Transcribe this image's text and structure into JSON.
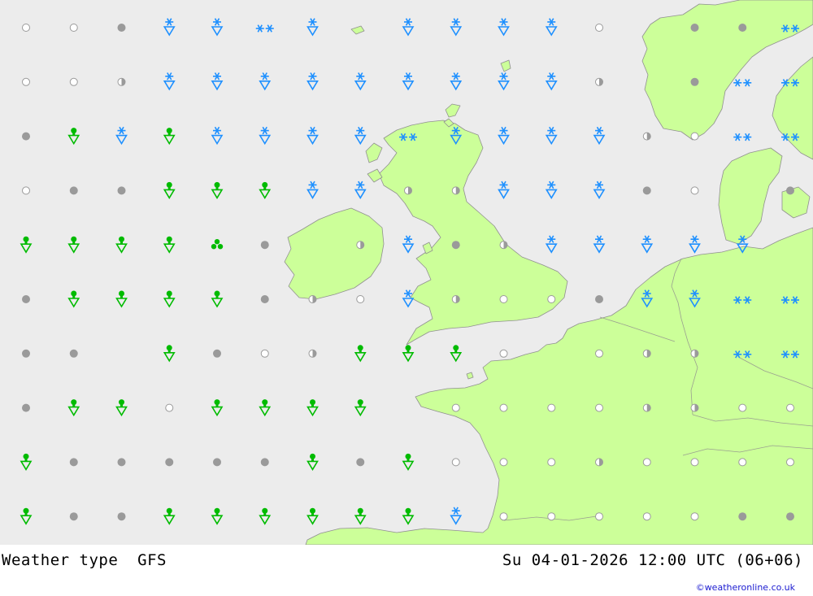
{
  "legend_title": "Weather type",
  "model": "GFS",
  "valid_time": "Su 04-01-2026 12:00 UTC (06+06)",
  "credit": "©weatheronline.co.uk",
  "colors": {
    "sea": "#ececec",
    "land": "#ccff99",
    "coast": "#909090",
    "snow": "#1e90ff",
    "rain": "#00bb00",
    "cloud": "#9a9a9a"
  },
  "legend": {
    "clear": "open circle",
    "partly_cloudy": "half-filled circle",
    "overcast": "filled gray circle",
    "rain": "green drop with triangle",
    "showers": "green clustered dots",
    "snow": "blue asterisk with triangle",
    "heavy_snow": "double blue asterisk"
  },
  "grid": {
    "rows": [
      [
        "clear",
        "clear",
        "overcast",
        "snow",
        "snow",
        "heavy_snow",
        "snow",
        "",
        "snow",
        "snow",
        "snow",
        "snow",
        "clear",
        "",
        "overcast",
        "overcast",
        "heavy_snow"
      ],
      [
        "clear",
        "clear",
        "partly_cloudy",
        "snow",
        "snow",
        "snow",
        "snow",
        "snow",
        "snow",
        "snow",
        "snow",
        "snow",
        "partly_cloudy",
        "",
        "overcast",
        "heavy_snow",
        "heavy_snow"
      ],
      [
        "overcast",
        "rain",
        "snow",
        "rain",
        "snow",
        "snow",
        "snow",
        "snow",
        "heavy_snow",
        "snow",
        "snow",
        "snow",
        "snow",
        "partly_cloudy",
        "clear",
        "heavy_snow",
        "heavy_snow"
      ],
      [
        "clear",
        "overcast",
        "overcast",
        "rain",
        "rain",
        "rain",
        "snow",
        "snow",
        "partly_cloudy",
        "partly_cloudy",
        "snow",
        "snow",
        "snow",
        "overcast",
        "clear",
        "",
        "overcast"
      ],
      [
        "rain",
        "rain",
        "rain",
        "rain",
        "showers",
        "overcast",
        "",
        "partly_cloudy",
        "snow",
        "overcast",
        "partly_cloudy",
        "snow",
        "snow",
        "snow",
        "snow",
        "snow",
        ""
      ],
      [
        "overcast",
        "rain",
        "rain",
        "rain",
        "rain",
        "overcast",
        "partly_cloudy",
        "clear",
        "snow",
        "partly_cloudy",
        "clear",
        "clear",
        "overcast",
        "snow",
        "snow",
        "heavy_snow",
        "heavy_snow"
      ],
      [
        "overcast",
        "overcast",
        "",
        "rain",
        "overcast",
        "clear",
        "partly_cloudy",
        "rain",
        "rain",
        "rain",
        "clear",
        "",
        "clear",
        "partly_cloudy",
        "partly_cloudy",
        "heavy_snow",
        "heavy_snow"
      ],
      [
        "overcast",
        "rain",
        "rain",
        "clear",
        "rain",
        "rain",
        "rain",
        "rain",
        "",
        "clear",
        "clear",
        "clear",
        "clear",
        "partly_cloudy",
        "partly_cloudy",
        "clear",
        "clear"
      ],
      [
        "rain",
        "overcast",
        "overcast",
        "overcast",
        "overcast",
        "overcast",
        "rain",
        "overcast",
        "rain",
        "clear",
        "clear",
        "clear",
        "partly_cloudy",
        "clear",
        "clear",
        "clear",
        "clear"
      ],
      [
        "rain",
        "overcast",
        "overcast",
        "rain",
        "rain",
        "rain",
        "rain",
        "rain",
        "rain",
        "snow",
        "clear",
        "clear",
        "clear",
        "clear",
        "clear",
        "overcast",
        "overcast"
      ]
    ]
  }
}
